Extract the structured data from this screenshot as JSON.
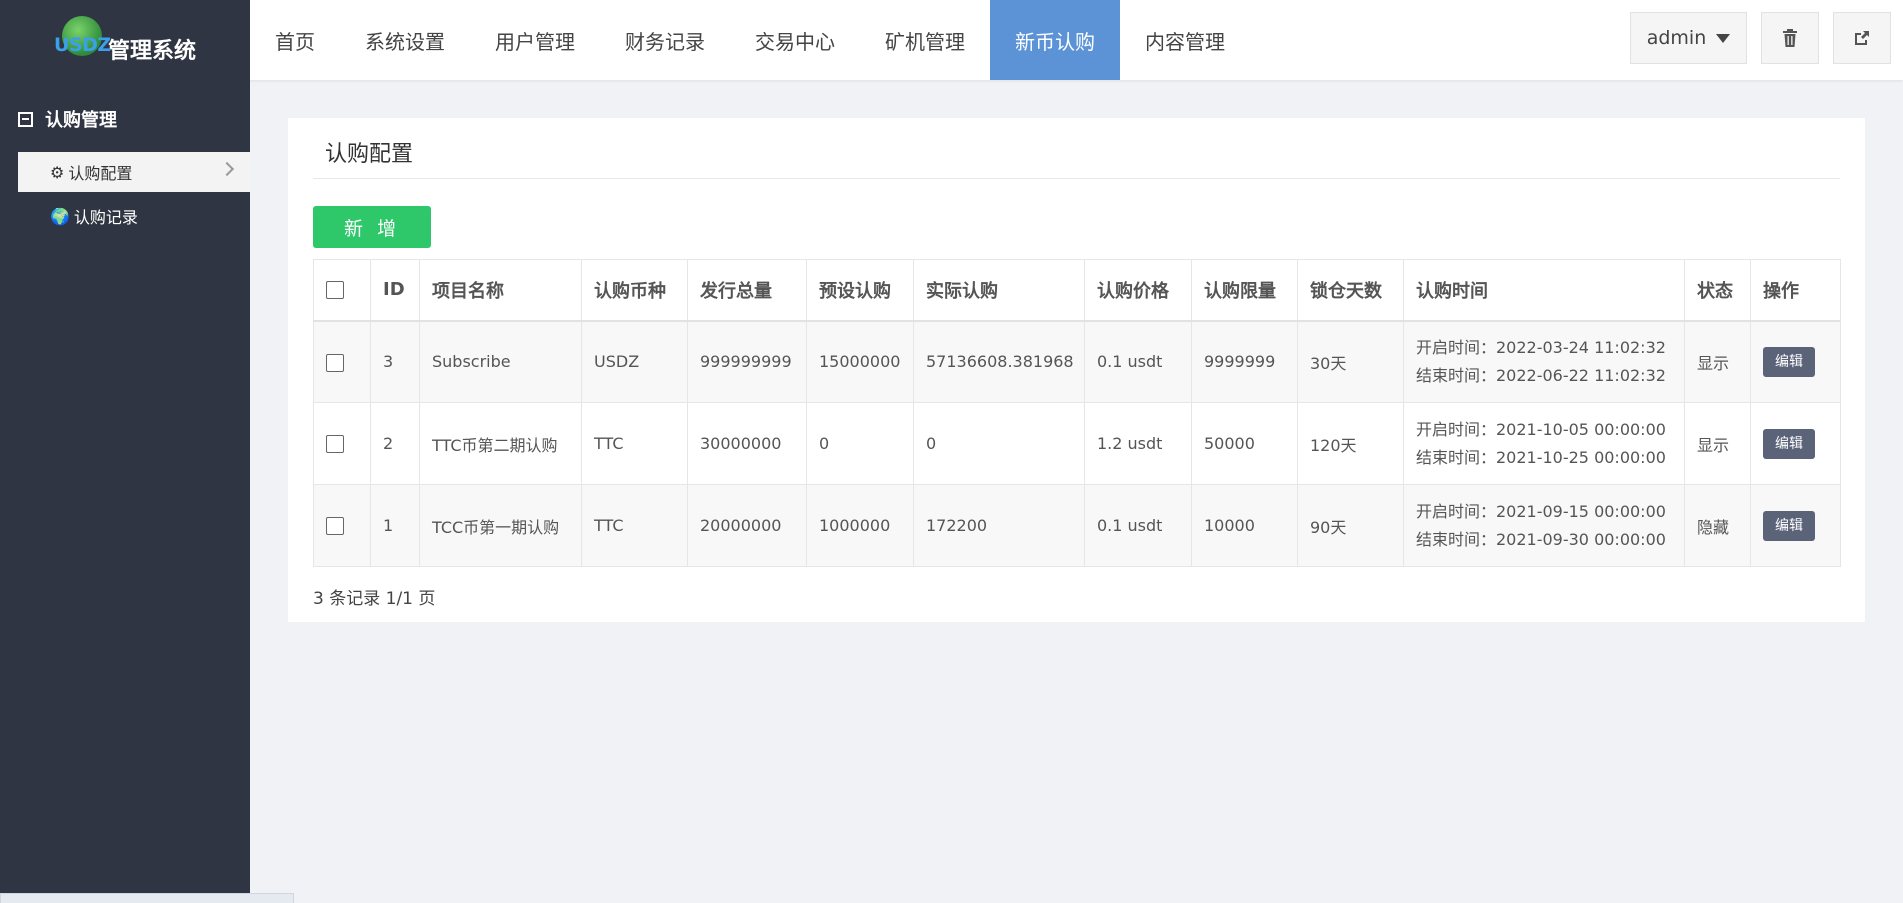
{
  "header": {
    "logo_word": "USDZ",
    "logo_title": "管理系统",
    "nav": [
      "首页",
      "系统设置",
      "用户管理",
      "财务记录",
      "交易中心",
      "矿机管理",
      "新币认购",
      "内容管理"
    ],
    "active_nav_index": 6,
    "user": "admin",
    "accent_color": "#5b93d6"
  },
  "sidebar": {
    "group_label": "认购管理",
    "items": [
      {
        "label": "认购配置",
        "icon": "gear-icon"
      },
      {
        "label": "认购记录",
        "icon": "globe-icon"
      }
    ]
  },
  "main": {
    "title": "认购配置",
    "add_label": "新 增",
    "columns": [
      "ID",
      "项目名称",
      "认购币种",
      "发行总量",
      "预设认购",
      "实际认购",
      "认购价格",
      "认购限量",
      "锁仓天数",
      "认购时间",
      "状态",
      "操作"
    ],
    "rows": [
      {
        "id": "3",
        "name": "Subscribe",
        "coin": "USDZ",
        "total": "999999999",
        "preset": "15000000",
        "actual": "57136608.381968",
        "price": "0.1 usdt",
        "limit": "9999999",
        "lock": "30天",
        "start": "开启时间：2022-03-24 11:02:32",
        "end": "结束时间：2022-06-22 11:02:32",
        "status": "显示",
        "op": "编辑"
      },
      {
        "id": "2",
        "name": "TTC币第二期认购",
        "coin": "TTC",
        "total": "30000000",
        "preset": "0",
        "actual": "0",
        "price": "1.2 usdt",
        "limit": "50000",
        "lock": "120天",
        "start": "开启时间：2021-10-05 00:00:00",
        "end": "结束时间：2021-10-25 00:00:00",
        "status": "显示",
        "op": "编辑"
      },
      {
        "id": "1",
        "name": "TCC币第一期认购",
        "coin": "TTC",
        "total": "20000000",
        "preset": "1000000",
        "actual": "172200",
        "price": "0.1 usdt",
        "limit": "10000",
        "lock": "90天",
        "start": "开启时间：2021-09-15 00:00:00",
        "end": "结束时间：2021-09-30 00:00:00",
        "status": "隐藏",
        "op": "编辑"
      }
    ],
    "footer": "3 条记录 1/1 页"
  }
}
